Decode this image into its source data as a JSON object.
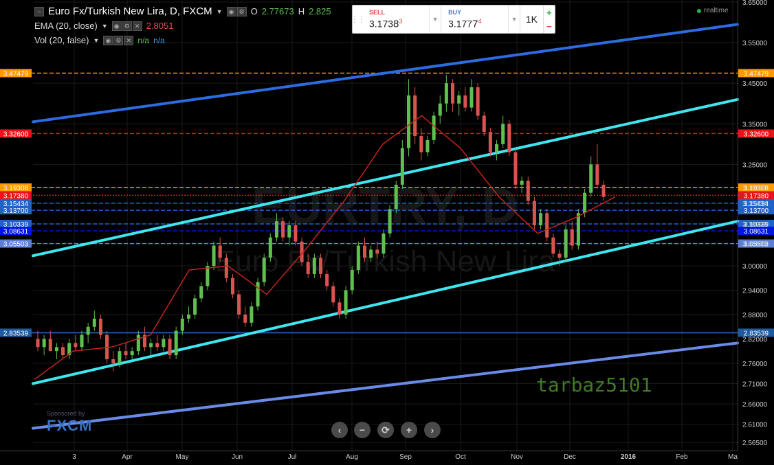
{
  "header": {
    "symbol_title": "Euro Fx/Turkish New Lira, D, FXCM",
    "ohlc_open_label": "O",
    "ohlc_open_value": "2.77673",
    "ohlc_high_label": "H",
    "ohlc_high_value": "2.825"
  },
  "indicators": {
    "ema_label": "EMA (20, close)",
    "ema_value": "2.8051",
    "vol_label": "Vol (20, false)",
    "vol_value_1": "n/a",
    "vol_value_2": "n/a"
  },
  "trade_panel": {
    "sell_label": "SELL",
    "sell_price_main": "3.173",
    "sell_price_pip": "8",
    "sell_price_frac": "3",
    "buy_label": "BUY",
    "buy_price_main": "3.177",
    "buy_price_pip": "7",
    "buy_price_frac": "4",
    "quantity": "1K",
    "plus": "+",
    "minus": "−"
  },
  "status": {
    "realtime": "realtime"
  },
  "watermark": {
    "symbol": "EURTRY, D",
    "name": "Euro Fx/Turkish New Lira"
  },
  "signature": "tarbaz5101",
  "sponsor": {
    "line1": "Sponsored by",
    "line2": "FXCM"
  },
  "zoom_controls": [
    "‹",
    "−",
    "⟳",
    "+",
    "›"
  ],
  "icons": {
    "menu": "collapse-icon",
    "settings": "gear-icon",
    "hide": "eye-icon",
    "remove": "close-icon"
  },
  "colors": {
    "bullish": "#5fbf4f",
    "bearish": "#d9534f",
    "ema": "#c0251d",
    "channel_cyan": "#3fe6f0",
    "channel_blue": "#2d6be0",
    "orange_level": "#ff9900",
    "red_level": "#e8141a",
    "blue_level": "#3d7ad6"
  },
  "chart_data": {
    "type": "candlestick",
    "title": "Euro Fx/Turkish New Lira, D, FXCM",
    "y_ticks": [
      "3.65000",
      "3.55000",
      "3.45000",
      "3.35000",
      "3.25000",
      "3.19308",
      "3.15434",
      "3.10339",
      "3.05503",
      "3.00000",
      "2.94000",
      "2.88000",
      "2.82000",
      "2.76000",
      "2.71000",
      "2.66000",
      "2.61000",
      "2.56500"
    ],
    "x_ticks": [
      "3",
      "Apr",
      "May",
      "Jun",
      "Jul",
      "Aug",
      "Sep",
      "Oct",
      "Nov",
      "Dec",
      "2016",
      "Feb",
      "Ma"
    ],
    "ylim": [
      2.545,
      3.655
    ],
    "horizontal_levels": [
      {
        "value": 3.47479,
        "label": "3.47479",
        "color": "#ff9900",
        "style": "dashed"
      },
      {
        "value": 3.326,
        "label": "3.32600",
        "color": "#e8141a",
        "style": "dashed"
      },
      {
        "value": 3.19308,
        "label": "3.19308",
        "color": "#ff9900",
        "style": "dashed"
      },
      {
        "value": 3.1738,
        "label": "3.17380",
        "color": "#e8141a",
        "style": "dotted"
      },
      {
        "value": 3.15434,
        "label": "3.15434",
        "color": "#1f63c9",
        "style": "dashed"
      },
      {
        "value": 3.137,
        "label": "3.13700",
        "color": "#1f63c9",
        "style": "dashed"
      },
      {
        "value": 3.10339,
        "label": "3.10339",
        "color": "#1f63c9",
        "style": "dashed"
      },
      {
        "value": 3.08631,
        "label": "3.08631",
        "color": "#0016e0",
        "style": "dashed"
      },
      {
        "value": 3.05503,
        "label": "3.05503",
        "color": "#5a7fd4",
        "style": "dashed"
      },
      {
        "value": 2.83539,
        "label": "2.83539",
        "color": "#1e5aa0",
        "style": "solid"
      }
    ],
    "trend_lines": [
      {
        "name": "upper-outer",
        "from": {
          "x": "Feb",
          "y": 3.355
        },
        "to": {
          "x": "Mar 2016",
          "y": 3.595
        },
        "color": "#2d6be0"
      },
      {
        "name": "upper-inner",
        "from": {
          "x": "Feb",
          "y": 3.025
        },
        "to": {
          "x": "Mar 2016",
          "y": 3.41
        },
        "color": "#3fe6f0"
      },
      {
        "name": "lower-inner",
        "from": {
          "x": "Feb",
          "y": 2.71
        },
        "to": {
          "x": "Mar 2016",
          "y": 3.11
        },
        "color": "#3fe6f0"
      },
      {
        "name": "lower-outer",
        "from": {
          "x": "Feb",
          "y": 2.6
        },
        "to": {
          "x": "Mar 2016",
          "y": 2.81
        },
        "color": "#6a8ae8"
      }
    ],
    "ema_points": [
      {
        "x": "Feb",
        "y": 2.72
      },
      {
        "x": "Mar",
        "y": 2.79
      },
      {
        "x": "Apr",
        "y": 2.8
      },
      {
        "x": "May",
        "y": 2.83
      },
      {
        "x": "Jun",
        "y": 2.99
      },
      {
        "x": "Jul",
        "y": 3.0
      },
      {
        "x": "Jul end",
        "y": 2.93
      },
      {
        "x": "Aug",
        "y": 3.04
      },
      {
        "x": "Aug end",
        "y": 3.16
      },
      {
        "x": "Sep",
        "y": 3.3
      },
      {
        "x": "Oct",
        "y": 3.37
      },
      {
        "x": "Oct end",
        "y": 3.29
      },
      {
        "x": "Nov",
        "y": 3.17
      },
      {
        "x": "Nov end",
        "y": 3.08
      },
      {
        "x": "Dec",
        "y": 3.12
      },
      {
        "x": "Dec mid",
        "y": 3.17
      }
    ],
    "candles": [
      {
        "o": 2.82,
        "h": 2.84,
        "l": 2.79,
        "c": 2.8
      },
      {
        "o": 2.8,
        "h": 2.83,
        "l": 2.78,
        "c": 2.82
      },
      {
        "o": 2.82,
        "h": 2.84,
        "l": 2.79,
        "c": 2.79
      },
      {
        "o": 2.79,
        "h": 2.81,
        "l": 2.77,
        "c": 2.8
      },
      {
        "o": 2.8,
        "h": 2.81,
        "l": 2.77,
        "c": 2.78
      },
      {
        "o": 2.78,
        "h": 2.82,
        "l": 2.77,
        "c": 2.81
      },
      {
        "o": 2.81,
        "h": 2.83,
        "l": 2.79,
        "c": 2.8
      },
      {
        "o": 2.8,
        "h": 2.84,
        "l": 2.79,
        "c": 2.83
      },
      {
        "o": 2.83,
        "h": 2.86,
        "l": 2.81,
        "c": 2.85
      },
      {
        "o": 2.85,
        "h": 2.89,
        "l": 2.84,
        "c": 2.87
      },
      {
        "o": 2.87,
        "h": 2.88,
        "l": 2.82,
        "c": 2.83
      },
      {
        "o": 2.83,
        "h": 2.84,
        "l": 2.76,
        "c": 2.77
      },
      {
        "o": 2.77,
        "h": 2.79,
        "l": 2.74,
        "c": 2.76
      },
      {
        "o": 2.76,
        "h": 2.8,
        "l": 2.75,
        "c": 2.79
      },
      {
        "o": 2.79,
        "h": 2.81,
        "l": 2.77,
        "c": 2.78
      },
      {
        "o": 2.78,
        "h": 2.8,
        "l": 2.77,
        "c": 2.79
      },
      {
        "o": 2.79,
        "h": 2.84,
        "l": 2.78,
        "c": 2.83
      },
      {
        "o": 2.83,
        "h": 2.85,
        "l": 2.79,
        "c": 2.8
      },
      {
        "o": 2.8,
        "h": 2.82,
        "l": 2.78,
        "c": 2.81
      },
      {
        "o": 2.81,
        "h": 2.83,
        "l": 2.79,
        "c": 2.8
      },
      {
        "o": 2.8,
        "h": 2.83,
        "l": 2.79,
        "c": 2.82
      },
      {
        "o": 2.82,
        "h": 2.83,
        "l": 2.77,
        "c": 2.78
      },
      {
        "o": 2.78,
        "h": 2.85,
        "l": 2.77,
        "c": 2.84
      },
      {
        "o": 2.84,
        "h": 2.88,
        "l": 2.83,
        "c": 2.87
      },
      {
        "o": 2.87,
        "h": 2.9,
        "l": 2.86,
        "c": 2.88
      },
      {
        "o": 2.88,
        "h": 2.93,
        "l": 2.87,
        "c": 2.92
      },
      {
        "o": 2.92,
        "h": 2.96,
        "l": 2.91,
        "c": 2.95
      },
      {
        "o": 2.95,
        "h": 3.01,
        "l": 2.94,
        "c": 3.0
      },
      {
        "o": 3.0,
        "h": 3.06,
        "l": 2.99,
        "c": 3.05
      },
      {
        "o": 3.05,
        "h": 3.07,
        "l": 3.01,
        "c": 3.02
      },
      {
        "o": 3.02,
        "h": 3.03,
        "l": 2.96,
        "c": 2.97
      },
      {
        "o": 2.97,
        "h": 2.98,
        "l": 2.92,
        "c": 2.93
      },
      {
        "o": 2.93,
        "h": 2.94,
        "l": 2.87,
        "c": 2.88
      },
      {
        "o": 2.88,
        "h": 2.9,
        "l": 2.85,
        "c": 2.86
      },
      {
        "o": 2.86,
        "h": 2.91,
        "l": 2.85,
        "c": 2.9
      },
      {
        "o": 2.9,
        "h": 2.97,
        "l": 2.89,
        "c": 2.96
      },
      {
        "o": 2.96,
        "h": 3.03,
        "l": 2.95,
        "c": 3.02
      },
      {
        "o": 3.02,
        "h": 3.08,
        "l": 3.01,
        "c": 3.07
      },
      {
        "o": 3.07,
        "h": 3.13,
        "l": 3.06,
        "c": 3.11
      },
      {
        "o": 3.11,
        "h": 3.12,
        "l": 3.06,
        "c": 3.07
      },
      {
        "o": 3.07,
        "h": 3.11,
        "l": 3.05,
        "c": 3.1
      },
      {
        "o": 3.1,
        "h": 3.11,
        "l": 3.05,
        "c": 3.06
      },
      {
        "o": 3.06,
        "h": 3.07,
        "l": 3.0,
        "c": 3.01
      },
      {
        "o": 3.01,
        "h": 3.03,
        "l": 2.97,
        "c": 2.98
      },
      {
        "o": 2.98,
        "h": 3.03,
        "l": 2.97,
        "c": 3.02
      },
      {
        "o": 3.02,
        "h": 3.03,
        "l": 2.97,
        "c": 2.98
      },
      {
        "o": 2.98,
        "h": 2.99,
        "l": 2.94,
        "c": 2.95
      },
      {
        "o": 2.95,
        "h": 2.96,
        "l": 2.9,
        "c": 2.91
      },
      {
        "o": 2.91,
        "h": 2.92,
        "l": 2.87,
        "c": 2.88
      },
      {
        "o": 2.88,
        "h": 2.95,
        "l": 2.87,
        "c": 2.94
      },
      {
        "o": 2.94,
        "h": 3.0,
        "l": 2.93,
        "c": 2.99
      },
      {
        "o": 2.99,
        "h": 3.06,
        "l": 2.98,
        "c": 3.05
      },
      {
        "o": 3.05,
        "h": 3.07,
        "l": 3.01,
        "c": 3.02
      },
      {
        "o": 3.02,
        "h": 3.05,
        "l": 3.01,
        "c": 3.04
      },
      {
        "o": 3.04,
        "h": 3.06,
        "l": 3.02,
        "c": 3.03
      },
      {
        "o": 3.03,
        "h": 3.09,
        "l": 3.02,
        "c": 3.08
      },
      {
        "o": 3.08,
        "h": 3.15,
        "l": 3.07,
        "c": 3.14
      },
      {
        "o": 3.14,
        "h": 3.21,
        "l": 3.13,
        "c": 3.2
      },
      {
        "o": 3.2,
        "h": 3.31,
        "l": 3.19,
        "c": 3.29
      },
      {
        "o": 3.29,
        "h": 3.46,
        "l": 3.27,
        "c": 3.42
      },
      {
        "o": 3.42,
        "h": 3.44,
        "l": 3.3,
        "c": 3.32
      },
      {
        "o": 3.32,
        "h": 3.34,
        "l": 3.26,
        "c": 3.28
      },
      {
        "o": 3.28,
        "h": 3.32,
        "l": 3.27,
        "c": 3.31
      },
      {
        "o": 3.31,
        "h": 3.38,
        "l": 3.3,
        "c": 3.37
      },
      {
        "o": 3.37,
        "h": 3.42,
        "l": 3.35,
        "c": 3.4
      },
      {
        "o": 3.4,
        "h": 3.47,
        "l": 3.38,
        "c": 3.45
      },
      {
        "o": 3.45,
        "h": 3.46,
        "l": 3.38,
        "c": 3.4
      },
      {
        "o": 3.4,
        "h": 3.43,
        "l": 3.37,
        "c": 3.42
      },
      {
        "o": 3.42,
        "h": 3.44,
        "l": 3.38,
        "c": 3.39
      },
      {
        "o": 3.39,
        "h": 3.46,
        "l": 3.38,
        "c": 3.44
      },
      {
        "o": 3.44,
        "h": 3.45,
        "l": 3.36,
        "c": 3.37
      },
      {
        "o": 3.37,
        "h": 3.38,
        "l": 3.32,
        "c": 3.33
      },
      {
        "o": 3.33,
        "h": 3.34,
        "l": 3.27,
        "c": 3.28
      },
      {
        "o": 3.28,
        "h": 3.31,
        "l": 3.26,
        "c": 3.3
      },
      {
        "o": 3.3,
        "h": 3.37,
        "l": 3.29,
        "c": 3.35
      },
      {
        "o": 3.35,
        "h": 3.36,
        "l": 3.27,
        "c": 3.28
      },
      {
        "o": 3.28,
        "h": 3.29,
        "l": 3.19,
        "c": 3.2
      },
      {
        "o": 3.2,
        "h": 3.22,
        "l": 3.18,
        "c": 3.21
      },
      {
        "o": 3.21,
        "h": 3.22,
        "l": 3.15,
        "c": 3.16
      },
      {
        "o": 3.16,
        "h": 3.17,
        "l": 3.09,
        "c": 3.1
      },
      {
        "o": 3.1,
        "h": 3.14,
        "l": 3.09,
        "c": 3.13
      },
      {
        "o": 3.13,
        "h": 3.14,
        "l": 3.06,
        "c": 3.07
      },
      {
        "o": 3.07,
        "h": 3.08,
        "l": 3.02,
        "c": 3.03
      },
      {
        "o": 3.03,
        "h": 3.04,
        "l": 3.0,
        "c": 3.02
      },
      {
        "o": 3.02,
        "h": 3.1,
        "l": 3.01,
        "c": 3.09
      },
      {
        "o": 3.09,
        "h": 3.11,
        "l": 3.04,
        "c": 3.05
      },
      {
        "o": 3.05,
        "h": 3.14,
        "l": 3.04,
        "c": 3.13
      },
      {
        "o": 3.13,
        "h": 3.19,
        "l": 3.12,
        "c": 3.18
      },
      {
        "o": 3.18,
        "h": 3.27,
        "l": 3.17,
        "c": 3.25
      },
      {
        "o": 3.25,
        "h": 3.3,
        "l": 3.19,
        "c": 3.2
      },
      {
        "o": 3.2,
        "h": 3.21,
        "l": 3.16,
        "c": 3.17
      }
    ]
  }
}
